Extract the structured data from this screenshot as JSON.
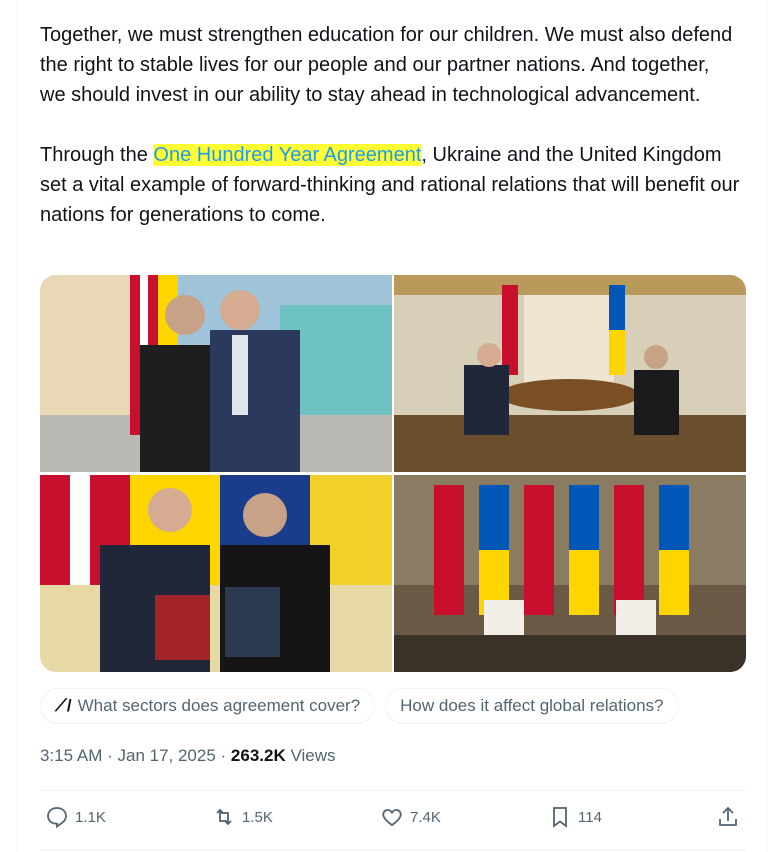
{
  "tweet": {
    "paragraph1": "Together, we must strengthen education for our children. We must also defend the right to stable lives for our people and our partner nations. And together, we should invest in our ability to stay ahead in technological advancement.",
    "paragraph2_pre": "Through the ",
    "paragraph2_highlight": "One Hundred Year Agreement",
    "paragraph2_post": ", Ukraine and the United Kingdom set a vital example of forward-thinking and rational relations that will benefit our nations for generations to come."
  },
  "media": {
    "images": [
      {
        "icon": "photo-handshake"
      },
      {
        "icon": "photo-meeting-table"
      },
      {
        "icon": "photo-signing-folders"
      },
      {
        "icon": "photo-press-conference"
      }
    ]
  },
  "grok_suggestions": [
    {
      "icon": "grok-icon",
      "label": "What sectors does agreement cover?"
    },
    {
      "label": "How does it affect global relations?"
    }
  ],
  "meta": {
    "time": "3:15 AM",
    "separator1": " · ",
    "date": "Jan 17, 2025",
    "separator2": " · ",
    "views_count": "263.2K",
    "views_label": " Views"
  },
  "actions": {
    "replies": "1.1K",
    "reposts": "1.5K",
    "likes": "7.4K",
    "bookmarks": "114"
  },
  "colors": {
    "text": "#0f1419",
    "muted": "#536471",
    "link": "#1d9bf0",
    "highlight": "#ffff33",
    "border": "#eff3f4"
  }
}
